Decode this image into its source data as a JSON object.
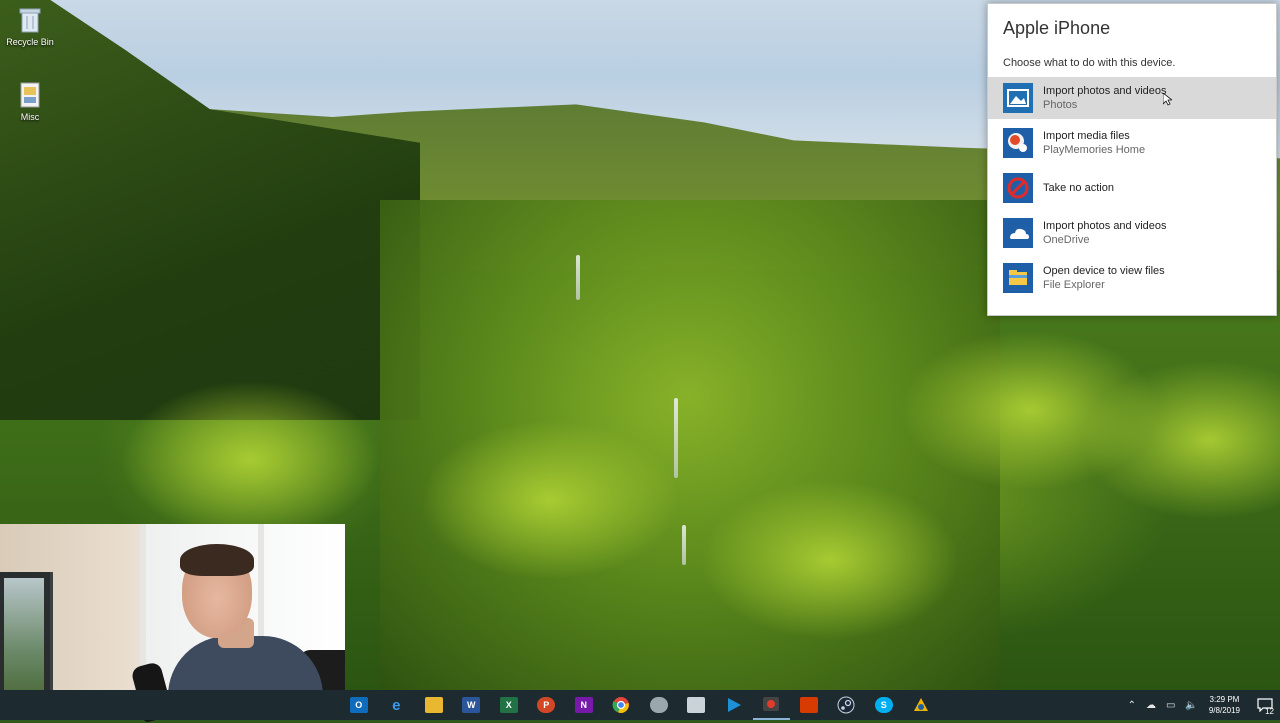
{
  "desktop": {
    "icons": [
      {
        "label": "Recycle Bin",
        "icon": "recycle-bin-icon"
      },
      {
        "label": "Misc",
        "icon": "folder-icon"
      }
    ]
  },
  "autoplay": {
    "title": "Apple iPhone",
    "subtitle": "Choose what to do with this device.",
    "options": [
      {
        "main": "Import photos and videos",
        "sub": "Photos",
        "icon": "photos-icon",
        "color": "#1f6fb2"
      },
      {
        "main": "Import media files",
        "sub": "PlayMemories Home",
        "icon": "playmemories-icon",
        "color": "#1f5fa8"
      },
      {
        "main": "Take no action",
        "sub": "",
        "icon": "no-action-icon",
        "color": "#1f5fa8"
      },
      {
        "main": "Import photos and videos",
        "sub": "OneDrive",
        "icon": "onedrive-icon",
        "color": "#1f5fa8"
      },
      {
        "main": "Open device to view files",
        "sub": "File Explorer",
        "icon": "file-explorer-icon",
        "color": "#1f5fa8"
      }
    ]
  },
  "taskbar": {
    "apps": [
      {
        "icon": "outlook-icon",
        "letter": "O",
        "color": "#0f6cbd"
      },
      {
        "icon": "edge-icon",
        "letter": "e",
        "color": "#1a7fd4"
      },
      {
        "icon": "file-explorer-icon",
        "letter": "",
        "color": "#e8b830"
      },
      {
        "icon": "word-icon",
        "letter": "W",
        "color": "#2b579a"
      },
      {
        "icon": "excel-icon",
        "letter": "X",
        "color": "#217346"
      },
      {
        "icon": "powerpoint-icon",
        "letter": "P",
        "color": "#d24726"
      },
      {
        "icon": "onenote-icon",
        "letter": "N",
        "color": "#7719aa"
      },
      {
        "icon": "chrome-icon",
        "letter": "",
        "color": "#e0463a"
      },
      {
        "icon": "app-icon",
        "letter": "",
        "color": "#9aa7ad"
      },
      {
        "icon": "snipping-icon",
        "letter": "",
        "color": "#c9d3d8"
      },
      {
        "icon": "media-player-icon",
        "letter": "",
        "color": "#1e90d6"
      },
      {
        "icon": "camtasia-icon",
        "letter": "",
        "color": "#444444"
      },
      {
        "icon": "office-icon",
        "letter": "",
        "color": "#d83b01"
      },
      {
        "icon": "steam-icon",
        "letter": "",
        "color": "#1b2838"
      },
      {
        "icon": "skype-icon",
        "letter": "S",
        "color": "#00aff0"
      },
      {
        "icon": "app2-icon",
        "letter": "",
        "color": "#f0b400"
      }
    ],
    "clock_time": "3:29 PM",
    "clock_date": "9/8/2019",
    "notification_count": "12"
  }
}
